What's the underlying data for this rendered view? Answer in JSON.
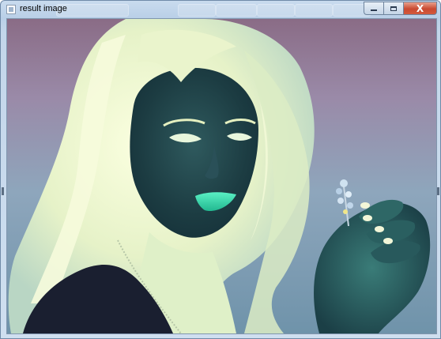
{
  "window": {
    "title": "result image",
    "icon": "app-window-icon"
  },
  "caption_buttons": {
    "minimize_icon": "minimize-icon",
    "maximize_icon": "maximize-icon",
    "close_label": "X",
    "close_color": "#c94a31"
  },
  "image": {
    "description_icon": "inverted-photo",
    "palette": {
      "background_top": "#8a6c86",
      "background_bottom": "#7fa0b4",
      "hair": "#f3f8d0",
      "face": "#1f4248",
      "lips": "#3de0b0",
      "shirt": "#1a1f30"
    }
  }
}
